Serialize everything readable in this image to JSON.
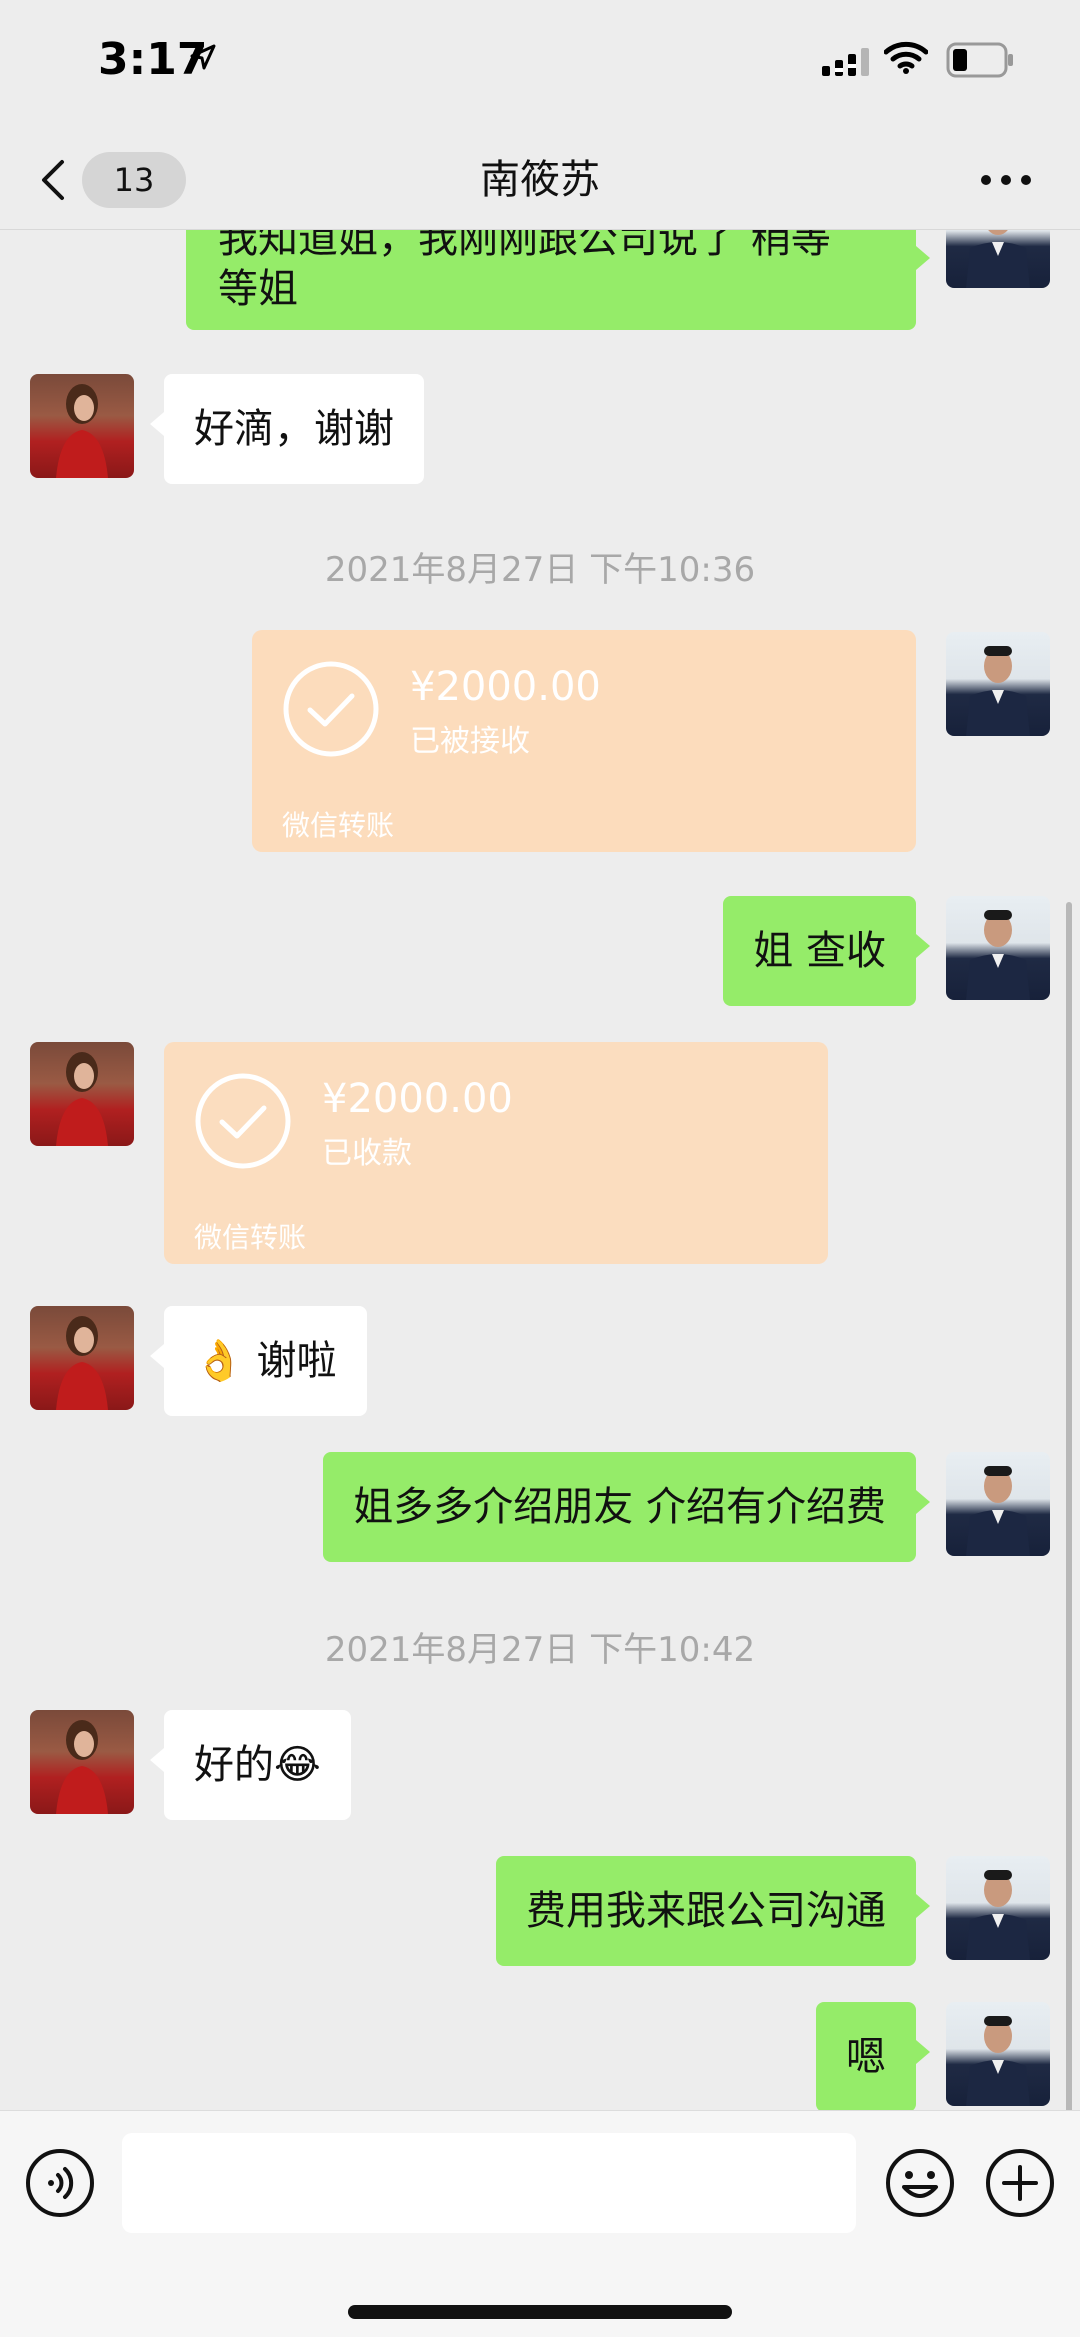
{
  "status_bar": {
    "time": "3:17"
  },
  "nav": {
    "unread_count": "13",
    "title": "南筱苏"
  },
  "messages": [
    {
      "side": "out",
      "type": "text",
      "text": "我知道姐，我刚刚跟公司说了 稍等等姐"
    },
    {
      "side": "in",
      "type": "text",
      "text": "好滴，谢谢"
    },
    {
      "type": "timestamp",
      "text": "2021年8月27日 下午10:36"
    },
    {
      "side": "out",
      "type": "transfer",
      "amount": "¥2000.00",
      "status": "已被接收",
      "label": "微信转账"
    },
    {
      "side": "out",
      "type": "text",
      "text": "姐 查收"
    },
    {
      "side": "in",
      "type": "transfer",
      "amount": "¥2000.00",
      "status": "已收款",
      "label": "微信转账"
    },
    {
      "side": "in",
      "type": "text",
      "text": "👌 谢啦"
    },
    {
      "side": "out",
      "type": "text",
      "text": "姐多多介绍朋友 介绍有介绍费"
    },
    {
      "type": "timestamp",
      "text": "2021年8月27日 下午10:42"
    },
    {
      "side": "in",
      "type": "text",
      "text": "好的😂"
    },
    {
      "side": "out",
      "type": "text",
      "text": "费用我来跟公司沟通"
    },
    {
      "side": "out",
      "type": "text",
      "text": "嗯"
    }
  ],
  "first_bubble_lines": [
    "我知道姐，我刚刚跟公司说了 稍等",
    "等姐"
  ],
  "input": {
    "value": "",
    "placeholder": ""
  },
  "colors": {
    "background": "#ededed",
    "outgoing_bubble": "#95ec69",
    "incoming_bubble": "#ffffff",
    "transfer_card": "#fcdcbc",
    "timestamp_text": "#a8a8a8"
  },
  "icons": {
    "status": [
      "location-arrow-icon",
      "cellular-signal-icon",
      "wifi-icon",
      "battery-icon"
    ],
    "nav": [
      "back-chevron-icon",
      "more-dots-icon"
    ],
    "transfer": "check-circle-icon",
    "input_bar": [
      "voice-icon",
      "emoji-icon",
      "plus-icon"
    ]
  }
}
